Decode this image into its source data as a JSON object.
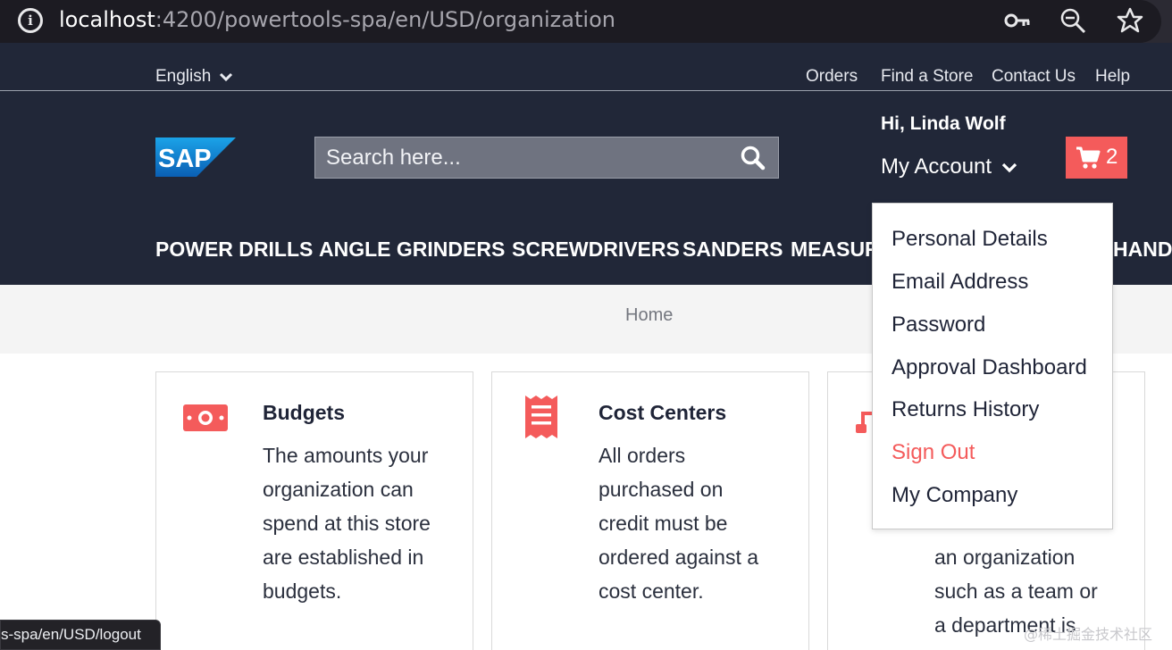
{
  "browser": {
    "url_host": "localhost",
    "url_path": ":4200/powertools-spa/en/USD/organization",
    "icons": [
      "info-icon",
      "key-icon",
      "zoom-icon",
      "star-icon"
    ]
  },
  "header": {
    "language": "English",
    "utility_links": [
      "Orders",
      "Find a Store",
      "Contact Us",
      "Help"
    ],
    "logo_text": "SAP",
    "search_placeholder": "Search here...",
    "greeting": "Hi, Linda Wolf",
    "my_account": "My Account",
    "cart_count": "2",
    "nav": [
      "POWER DRILLS",
      "ANGLE GRINDERS",
      "SCREWDRIVERS",
      "SANDERS",
      "MEASUR",
      "HAND"
    ]
  },
  "breadcrumb": "Home",
  "cards": [
    {
      "title": "Budgets",
      "icon": "money-icon",
      "lines": [
        "The amounts your",
        "organization can",
        "spend at this store",
        "are established in",
        "budgets."
      ]
    },
    {
      "title": "Cost Centers",
      "icon": "receipt-icon",
      "lines": [
        "All orders",
        "purchased on",
        "credit must be",
        "ordered against a",
        "cost center."
      ]
    },
    {
      "title": "",
      "icon": "sitemap-icon",
      "lines": [
        "an organization",
        "such as a team or",
        "a department is"
      ]
    }
  ],
  "account_menu": {
    "items": [
      "Personal Details",
      "Email Address",
      "Password",
      "Approval Dashboard",
      "Returns History",
      "Sign Out",
      "My Company"
    ]
  },
  "status_bar": "s-spa/en/USD/logout",
  "watermark": "@稀土掘金技术社区",
  "colors": {
    "header_bg": "#212738",
    "accent": "#f45b5b",
    "search_bg": "#6f7380"
  }
}
